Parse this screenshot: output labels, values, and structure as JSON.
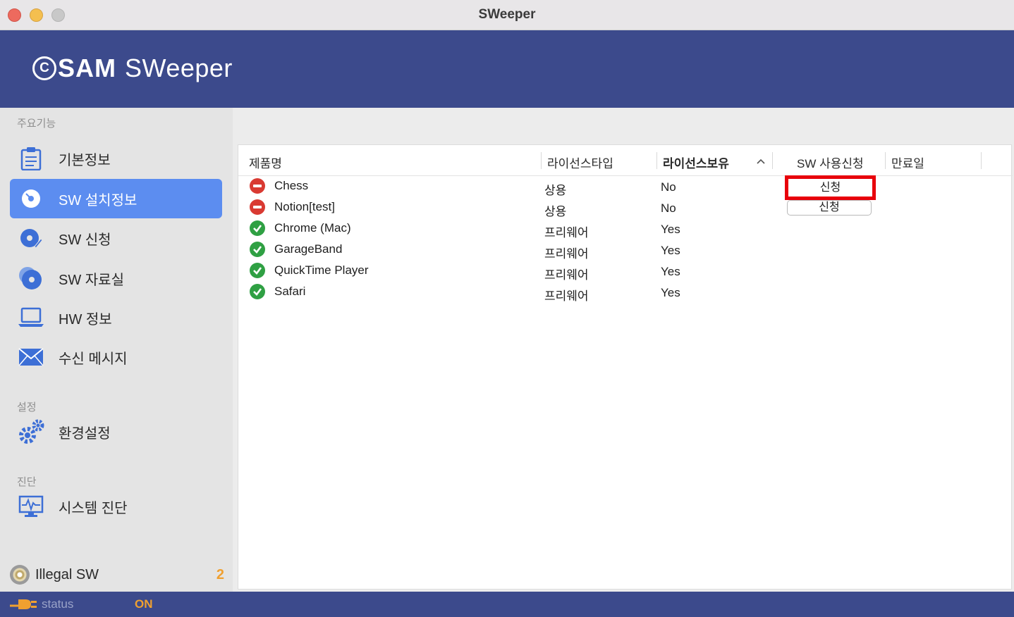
{
  "window": {
    "title": "SWeeper"
  },
  "banner": {
    "logo_mark": "C",
    "logo_sam": "SAM",
    "logo_sweeper": "SWeeper"
  },
  "sidebar": {
    "section_main": "주요기능",
    "items": [
      {
        "label": "기본정보",
        "icon": "clipboard-icon"
      },
      {
        "label": "SW 설치정보",
        "icon": "disc-icon",
        "active": true
      },
      {
        "label": "SW 신청",
        "icon": "disc-pen-icon"
      },
      {
        "label": "SW 자료실",
        "icon": "disc-stack-icon"
      },
      {
        "label": "HW 정보",
        "icon": "laptop-icon"
      },
      {
        "label": "수신 메시지",
        "icon": "envelope-icon"
      }
    ],
    "section_settings": "설정",
    "settings_item": {
      "label": "환경설정",
      "icon": "gears-icon"
    },
    "section_diag": "진단",
    "diag_item": {
      "label": "시스템 진단",
      "icon": "monitor-pulse-icon"
    },
    "illegal": {
      "label": "Illegal SW",
      "count": "2"
    }
  },
  "statusbar": {
    "label": "status",
    "value": "ON"
  },
  "table": {
    "columns": [
      "제품명",
      "라이선스타입",
      "라이선스보유",
      "SW 사용신청",
      "만료일"
    ],
    "sorted_column": "라이선스보유",
    "rows": [
      {
        "status": "unlicensed",
        "name": "Chess",
        "type": "상용",
        "owned": "No",
        "apply": "신청"
      },
      {
        "status": "unlicensed",
        "name": "Notion[test]",
        "type": "상용",
        "owned": "No",
        "apply": "신청"
      },
      {
        "status": "ok",
        "name": "Chrome (Mac)",
        "type": "프리웨어",
        "owned": "Yes",
        "apply": ""
      },
      {
        "status": "ok",
        "name": "GarageBand",
        "type": "프리웨어",
        "owned": "Yes",
        "apply": ""
      },
      {
        "status": "ok",
        "name": "QuickTime Player",
        "type": "프리웨어",
        "owned": "Yes",
        "apply": ""
      },
      {
        "status": "ok",
        "name": "Safari",
        "type": "프리웨어",
        "owned": "Yes",
        "apply": ""
      }
    ]
  },
  "colors": {
    "brand": "#3c4a8c",
    "active_nav": "#5c8df0",
    "accent_orange": "#f0a030",
    "status_red": "#d93a32",
    "status_green": "#2fa043",
    "highlight": "#e8000b"
  }
}
